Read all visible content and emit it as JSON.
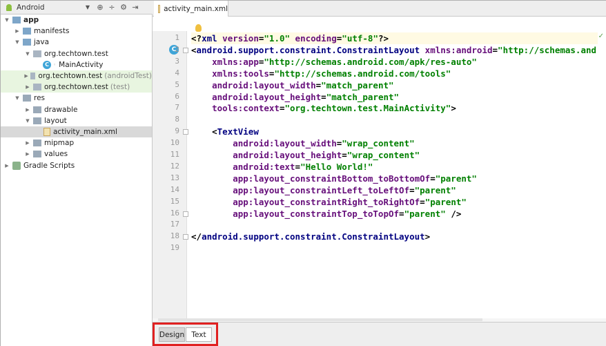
{
  "project_panel": {
    "view_label": "Android",
    "toolbar_icons": [
      "sync-icon",
      "collapse-icon",
      "settings-icon",
      "hide-icon"
    ],
    "tree": [
      {
        "label": "app",
        "indent": 0,
        "icon": "folder-blue",
        "arrow": "down",
        "bold": true
      },
      {
        "label": "manifests",
        "indent": 1,
        "icon": "folder-blue",
        "arrow": "right"
      },
      {
        "label": "java",
        "indent": 1,
        "icon": "folder-blue",
        "arrow": "down"
      },
      {
        "label": "org.techtown.test",
        "indent": 2,
        "icon": "folder-pkg",
        "arrow": "down"
      },
      {
        "label": "MainActivity",
        "indent": 3,
        "icon": "class",
        "arrow": "none"
      },
      {
        "label": "org.techtown.test",
        "suffix": "(androidTest)",
        "indent": 2,
        "icon": "folder-pkg",
        "arrow": "right",
        "green": true
      },
      {
        "label": "org.techtown.test",
        "suffix": "(test)",
        "indent": 2,
        "icon": "folder-pkg",
        "arrow": "right",
        "green": true
      },
      {
        "label": "res",
        "indent": 1,
        "icon": "folder-gray",
        "arrow": "down"
      },
      {
        "label": "drawable",
        "indent": 2,
        "icon": "folder-gray",
        "arrow": "right"
      },
      {
        "label": "layout",
        "indent": 2,
        "icon": "folder-gray",
        "arrow": "down"
      },
      {
        "label": "activity_main.xml",
        "indent": 3,
        "icon": "xml",
        "arrow": "none",
        "selected": true
      },
      {
        "label": "mipmap",
        "indent": 2,
        "icon": "folder-gray",
        "arrow": "right"
      },
      {
        "label": "values",
        "indent": 2,
        "icon": "folder-gray",
        "arrow": "right"
      },
      {
        "label": "Gradle Scripts",
        "indent": 0,
        "icon": "gradle",
        "arrow": "right"
      }
    ]
  },
  "editor": {
    "tab_label": "activity_main.xml",
    "current_line": 1,
    "lines": [
      [
        [
          "punct",
          "<?"
        ],
        [
          "tag",
          "xml "
        ],
        [
          "attr",
          "version"
        ],
        [
          "punct",
          "="
        ],
        [
          "val",
          "\"1.0\" "
        ],
        [
          "attr",
          "encoding"
        ],
        [
          "punct",
          "="
        ],
        [
          "val",
          "\"utf-8\""
        ],
        [
          "punct",
          "?>"
        ]
      ],
      [
        [
          "punct",
          "<"
        ],
        [
          "tag",
          "android.support.constraint.ConstraintLayout "
        ],
        [
          "attr",
          "xmlns:android"
        ],
        [
          "punct",
          "="
        ],
        [
          "val",
          "\"http://schemas.and"
        ]
      ],
      [
        [
          "plain",
          "    "
        ],
        [
          "attr",
          "xmlns:app"
        ],
        [
          "punct",
          "="
        ],
        [
          "val",
          "\"http://schemas.android.com/apk/res-auto\""
        ]
      ],
      [
        [
          "plain",
          "    "
        ],
        [
          "attr",
          "xmlns:tools"
        ],
        [
          "punct",
          "="
        ],
        [
          "val",
          "\"http://schemas.android.com/tools\""
        ]
      ],
      [
        [
          "plain",
          "    "
        ],
        [
          "attr",
          "android:layout_width"
        ],
        [
          "punct",
          "="
        ],
        [
          "val",
          "\"match_parent\""
        ]
      ],
      [
        [
          "plain",
          "    "
        ],
        [
          "attr",
          "android:layout_height"
        ],
        [
          "punct",
          "="
        ],
        [
          "val",
          "\"match_parent\""
        ]
      ],
      [
        [
          "plain",
          "    "
        ],
        [
          "attr",
          "tools:context"
        ],
        [
          "punct",
          "="
        ],
        [
          "val",
          "\"org.techtown.test.MainActivity\""
        ],
        [
          "punct",
          ">"
        ]
      ],
      [],
      [
        [
          "plain",
          "    "
        ],
        [
          "punct",
          "<"
        ],
        [
          "tag",
          "TextView"
        ]
      ],
      [
        [
          "plain",
          "        "
        ],
        [
          "attr",
          "android:layout_width"
        ],
        [
          "punct",
          "="
        ],
        [
          "val",
          "\"wrap_content\""
        ]
      ],
      [
        [
          "plain",
          "        "
        ],
        [
          "attr",
          "android:layout_height"
        ],
        [
          "punct",
          "="
        ],
        [
          "val",
          "\"wrap_content\""
        ]
      ],
      [
        [
          "plain",
          "        "
        ],
        [
          "attr",
          "android:text"
        ],
        [
          "punct",
          "="
        ],
        [
          "val",
          "\"Hello World!\""
        ]
      ],
      [
        [
          "plain",
          "        "
        ],
        [
          "attr",
          "app:layout_constraintBottom_toBottomOf"
        ],
        [
          "punct",
          "="
        ],
        [
          "val",
          "\"parent\""
        ]
      ],
      [
        [
          "plain",
          "        "
        ],
        [
          "attr",
          "app:layout_constraintLeft_toLeftOf"
        ],
        [
          "punct",
          "="
        ],
        [
          "val",
          "\"parent\""
        ]
      ],
      [
        [
          "plain",
          "        "
        ],
        [
          "attr",
          "app:layout_constraintRight_toRightOf"
        ],
        [
          "punct",
          "="
        ],
        [
          "val",
          "\"parent\""
        ]
      ],
      [
        [
          "plain",
          "        "
        ],
        [
          "attr",
          "app:layout_constraintTop_toTopOf"
        ],
        [
          "punct",
          "="
        ],
        [
          "val",
          "\"parent\" "
        ],
        [
          "punct",
          "/>"
        ]
      ],
      [],
      [
        [
          "punct",
          "</"
        ],
        [
          "tag",
          "android.support.constraint.ConstraintLayout"
        ],
        [
          "punct",
          ">"
        ]
      ],
      []
    ],
    "fold_lines": [
      2,
      9,
      16,
      18
    ]
  },
  "bottom_tabs": {
    "design_label": "Design",
    "text_label": "Text",
    "active": "Text"
  }
}
